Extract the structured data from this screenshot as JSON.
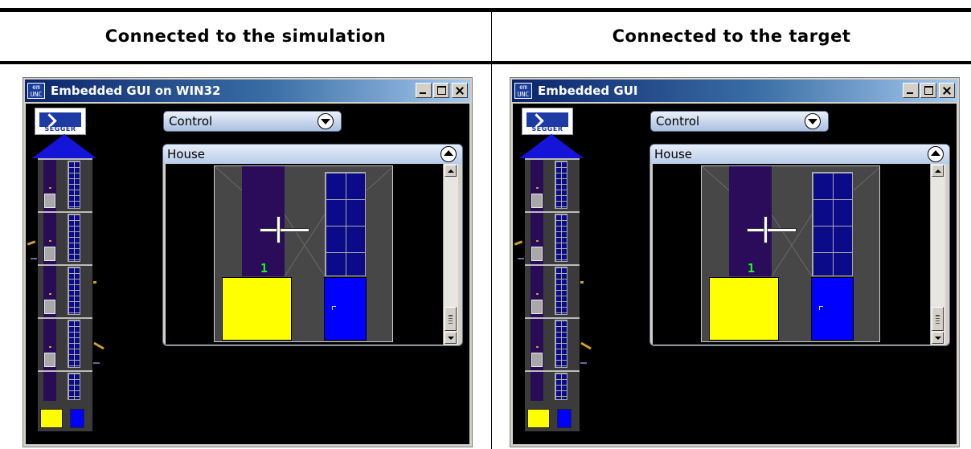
{
  "columns": [
    {
      "heading": "Connected to the simulation",
      "window": {
        "title": "Embedded GUI on WIN32",
        "app_icon_text": "em UNC",
        "logo_text": "SEGGER",
        "control": {
          "label": "Control"
        },
        "house": {
          "label": "House",
          "floor_number": "1"
        }
      }
    },
    {
      "heading": "Connected to the target",
      "window": {
        "title": "Embedded GUI",
        "app_icon_text": "em UNC",
        "logo_text": "SEGGER",
        "control": {
          "label": "Control"
        },
        "house": {
          "label": "House",
          "floor_number": "1"
        }
      }
    }
  ],
  "colors": {
    "titlebar_start": "#0a246a",
    "titlebar_end": "#a6caf0",
    "elevator_cabin": "#ffff00",
    "door": "#0000ff",
    "shaft": "#2a0c5a",
    "floor_number": "#1aff1a"
  }
}
